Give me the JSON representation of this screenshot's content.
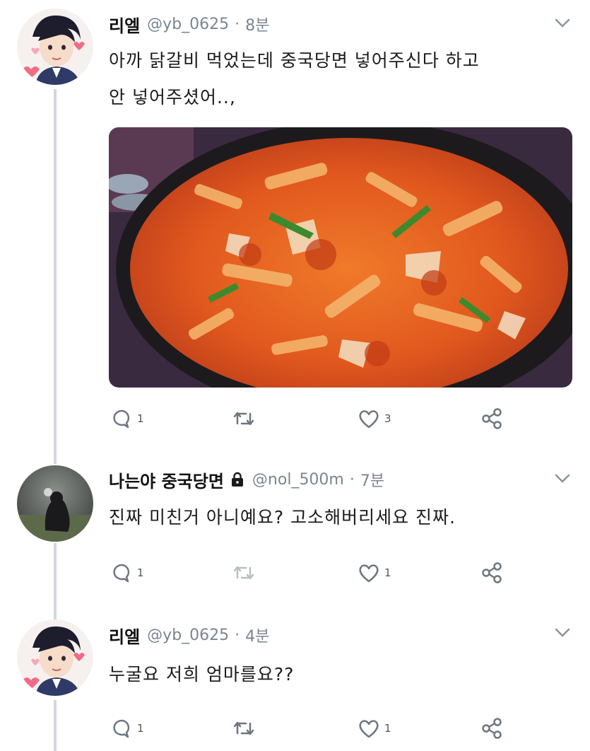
{
  "tweets": [
    {
      "name": "리엘",
      "handle": "@yb_0625",
      "time": "8분",
      "text_lines": [
        "아까 닭갈비 먹었는데 중국당면 넣어주신다 하고",
        "안 넣어주셨어..,"
      ],
      "has_photo": true,
      "photo_description_icon": "food-photo",
      "replies": "1",
      "retweets": "",
      "likes": "3"
    },
    {
      "name": "나는야 중국당면",
      "handle": "@nol_500m",
      "time": "7분",
      "protected": true,
      "text_lines": [
        "진짜 미친거 아니예요? 고소해버리세요 진짜."
      ],
      "replies": "1",
      "retweets": "",
      "likes": "1"
    },
    {
      "name": "리엘",
      "handle": "@yb_0625",
      "time": "4분",
      "text_lines": [
        "누굴요 저희 엄마를요??"
      ],
      "replies": "1",
      "retweets": "",
      "likes": "1"
    }
  ],
  "separator": "·",
  "colors": {
    "secondary_text": "#7b8591",
    "thread_line": "#d3d7dc",
    "icon": "#6e7781"
  },
  "icons": [
    "chevron-down-icon",
    "reply-icon",
    "retweet-icon",
    "like-icon",
    "share-icon",
    "lock-icon"
  ]
}
